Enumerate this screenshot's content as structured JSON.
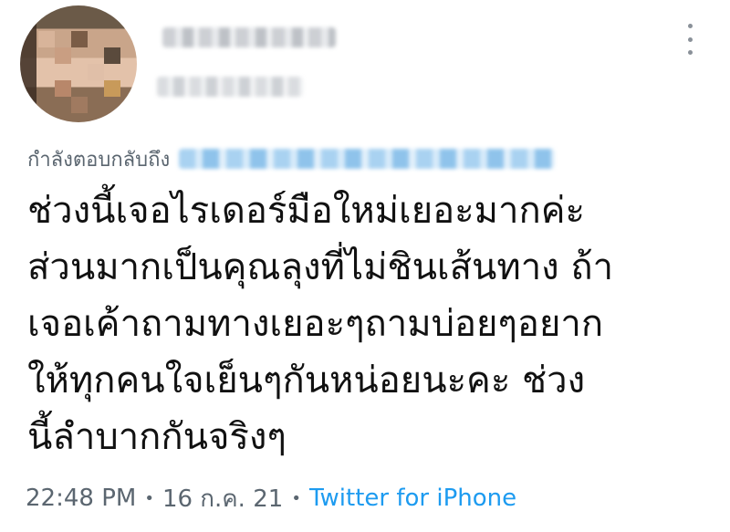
{
  "header": {
    "avatar_icon": "avatar-photo-icon",
    "more_icon": "more-vertical-icon"
  },
  "reply": {
    "label": "กำลังตอบกลับถึง"
  },
  "tweet": {
    "lines": [
      "ช่วงนี้เจอไรเดอร์มือใหม่เยอะมากค่ะ",
      "ส่วนมากเป็นคุณลุงที่ไม่ชินเส้นทาง ถ้า",
      "เจอเค้าถามทางเยอะๆถามบ่อยๆอยาก",
      "ให้ทุกคนใจเย็นๆกันหน่อยนะคะ ช่วง",
      "นี้ลำบากกันจริงๆ"
    ]
  },
  "meta": {
    "time": "22:48 PM",
    "separator": "•",
    "date": "16 ก.ค. 21",
    "source": "Twitter for iPhone"
  },
  "colors": {
    "text": "#111111",
    "secondary": "#5b6670",
    "link": "#1d9bf0"
  }
}
